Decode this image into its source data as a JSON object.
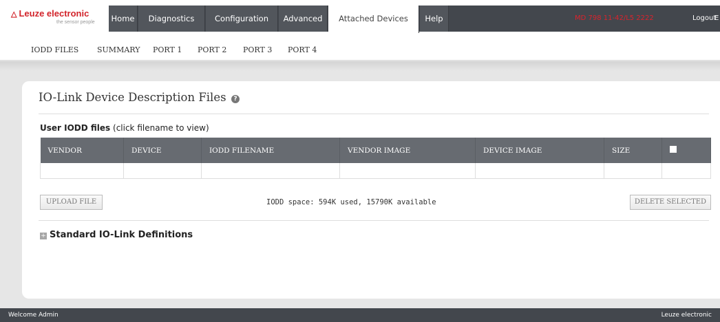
{
  "brand": {
    "name": "Leuze electronic",
    "tagline": "the sensor people",
    "color": "#d2232a"
  },
  "nav": {
    "items": [
      {
        "label": "Home"
      },
      {
        "label": "Diagnostics"
      },
      {
        "label": "Configuration"
      },
      {
        "label": "Advanced"
      },
      {
        "label": "Attached Devices",
        "active": true
      },
      {
        "label": "Help"
      }
    ],
    "user_info": "MD 798 11-42/L5 2222",
    "logout": "Logout",
    "extra": "E"
  },
  "subnav": {
    "items": [
      "IODD FILES",
      "SUMMARY",
      "PORT 1",
      "PORT 2",
      "PORT 3",
      "PORT 4"
    ]
  },
  "main": {
    "title": "IO-Link Device Description Files",
    "help_icon": "question-icon",
    "user_files_heading": "User IODD files",
    "user_files_hint": "(click filename to view)",
    "table": {
      "columns": [
        "VENDOR",
        "DEVICE",
        "IODD FILENAME",
        "VENDOR IMAGE",
        "DEVICE IMAGE",
        "SIZE"
      ],
      "rows": []
    },
    "upload_button": "UPLOAD FILE",
    "space_info": "IODD space: 594K used, 15790K available",
    "delete_button": "DELETE SELECTED",
    "expand_icon": "plus-square-icon",
    "expand_symbol": "+",
    "standard_defs": "Standard IO-Link Definitions"
  },
  "footer": {
    "welcome": "Welcome Admin",
    "company": "Leuze electronic"
  }
}
